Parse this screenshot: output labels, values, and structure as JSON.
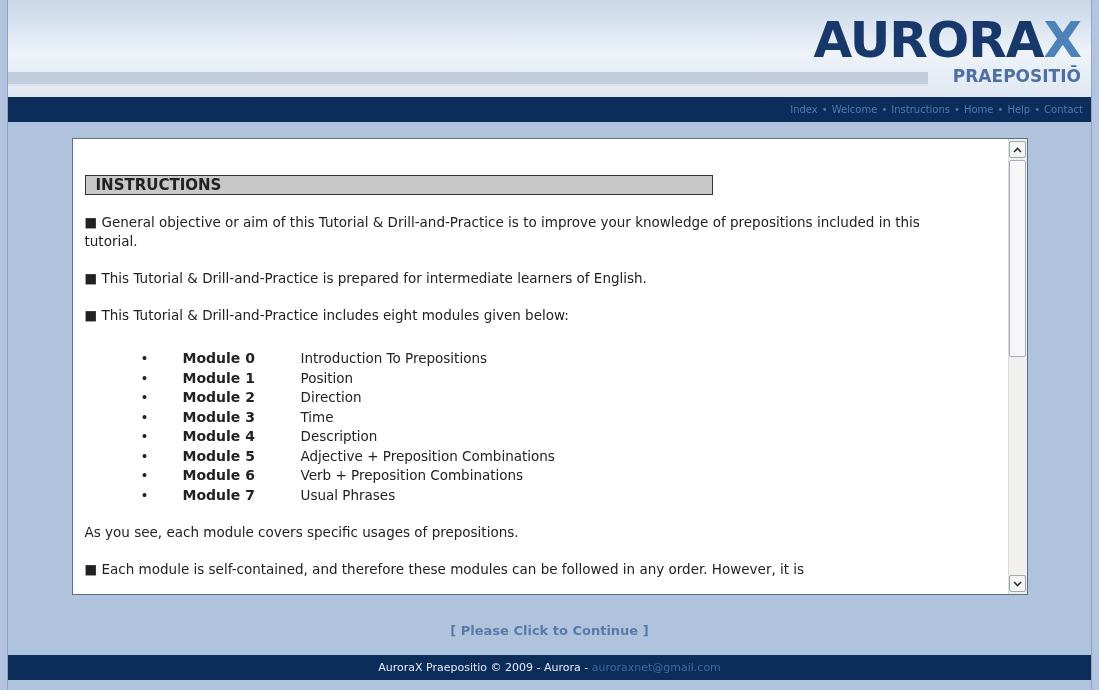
{
  "logo": {
    "main": "AURORA",
    "accent": "X",
    "subtitle": "PRAEPOSITIŌ"
  },
  "nav": {
    "separator": "•",
    "links": [
      "Index",
      "Welcome",
      "Instructions",
      "Home",
      "Help",
      "Contact"
    ]
  },
  "content": {
    "heading": "INSTRUCTIONS",
    "paragraphs_before": [
      "■ General objective or aim of this Tutorial & Drill-and-Practice is to improve your knowledge of prepositions included in this tutorial.",
      "■ This Tutorial & Drill-and-Practice is prepared for intermediate learners of English.",
      "■ This Tutorial & Drill-and-Practice includes eight modules given below:"
    ],
    "modules": [
      {
        "bullet": "•",
        "name": "Module 0",
        "topic": "Introduction To Prepositions"
      },
      {
        "bullet": "•",
        "name": "Module 1",
        "topic": "Position"
      },
      {
        "bullet": "•",
        "name": "Module 2",
        "topic": "Direction"
      },
      {
        "bullet": "•",
        "name": "Module 3",
        "topic": "Time"
      },
      {
        "bullet": "•",
        "name": "Module 4",
        "topic": "Description"
      },
      {
        "bullet": "•",
        "name": "Module 5",
        "topic": "Adjective + Preposition Combinations"
      },
      {
        "bullet": "•",
        "name": "Module 6",
        "topic": "Verb + Preposition Combinations"
      },
      {
        "bullet": "•",
        "name": "Module 7",
        "topic": "Usual Phrases"
      }
    ],
    "paragraphs_after": [
      "As you see, each module covers specific usages of prepositions.",
      "■ Each module is self-contained, and therefore these modules can be followed in any order. However, it is"
    ]
  },
  "continue_link": "[ Please Click to Continue ]",
  "footer": {
    "text": "AuroraX Praepositio © 2009 - Aurora - ",
    "email": "auroraxnet@gmail.com"
  }
}
